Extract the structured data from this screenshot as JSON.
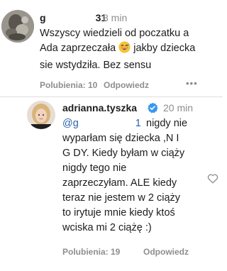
{
  "comment1": {
    "username_prefix": "g",
    "username_suffix": "31",
    "time": "8 min",
    "text_line1": "Wszyscy wiedzieli od poczatku a",
    "text_line2a": "Ada zaprzeczała",
    "text_line2b": "jakby dziecka",
    "text_line3": "sie wstydziła. Bez sensu",
    "emoji_icon": "grinning-sweat-emoji",
    "likes": "Polubienia: 10",
    "reply_label": "Odpowiedz",
    "more_label": "•••"
  },
  "comment2": {
    "username": "adrianna.tyszka",
    "verified_icon": "verified-badge-icon",
    "time": "20 min",
    "mention_prefix": "@g",
    "mention_suffix": "1",
    "text_after_mention": "nigdy nie",
    "text_rest": "wyparłam się dziecka ,N I G DY. Kiedy byłam w ciąży nigdy tego nie zaprzeczyłam. ALE kiedy teraz nie jestem w 2 ciąży to irytuje mnie kiedy ktoś wciska mi 2 ciążę :)",
    "likes": "Polubienia: 19",
    "reply_label": "Odpowiedz",
    "heart_icon": "heart-outline-icon"
  },
  "colors": {
    "text": "#1c1c1c",
    "muted": "#8e8e8e",
    "mention": "#2a63a8",
    "verified": "#3797f0"
  }
}
